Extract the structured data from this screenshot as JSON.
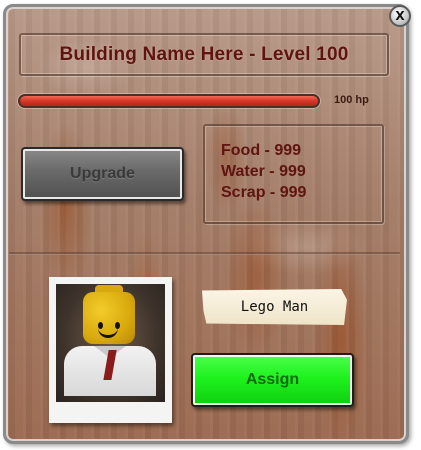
{
  "close_button": {
    "label": "X",
    "icon": "close-icon"
  },
  "building": {
    "title": "Building Name Here - Level 100",
    "hp_label": "100 hp",
    "hp_fraction": 1.0
  },
  "upgrade": {
    "label": "Upgrade"
  },
  "resources": [
    {
      "text": "Food - 999"
    },
    {
      "text": "Water - 999"
    },
    {
      "text": "Scrap - 999"
    }
  ],
  "worker": {
    "name": "Lego Man",
    "portrait_icon": "lego-minifigure-portrait"
  },
  "assign": {
    "label": "Assign"
  },
  "colors": {
    "title_text": "#5e1410",
    "hp_bar": "#d9392a",
    "upgrade_button": "#6c6c6c",
    "assign_button": "#1ef21e",
    "assign_text": "#0d6b0d"
  }
}
